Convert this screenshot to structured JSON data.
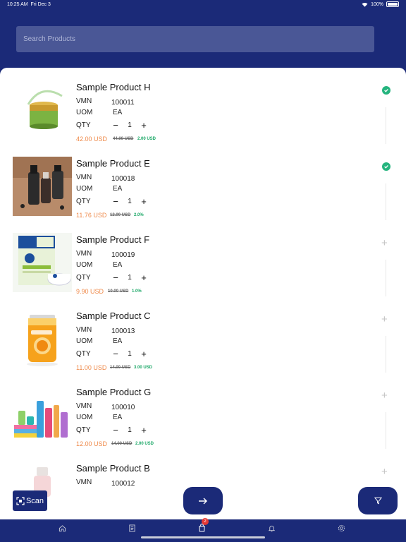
{
  "status_bar": {
    "time": "10:25 AM",
    "date": "Fri Dec 3",
    "battery": "100%"
  },
  "search": {
    "placeholder": "Search Products"
  },
  "labels": {
    "vmn": "VMN",
    "uom": "UOM",
    "qty": "QTY"
  },
  "products": [
    {
      "name": "Sample Product H",
      "vmn": "100011",
      "uom": "EA",
      "qty": "1",
      "price": "42.00 USD",
      "old_price": "44.00 USD",
      "discount": "2.00 USD",
      "selected": true,
      "image": "green-cream-jar"
    },
    {
      "name": "Sample Product E",
      "vmn": "100018",
      "uom": "EA",
      "qty": "1",
      "price": "11.76 USD",
      "old_price": "12.00 USD",
      "discount": "2.0%",
      "selected": true,
      "image": "serum-bottles"
    },
    {
      "name": "Sample Product F",
      "vmn": "100019",
      "uom": "EA",
      "qty": "1",
      "price": "9.90 USD",
      "old_price": "10.00 USD",
      "discount": "1.0%",
      "selected": false,
      "image": "nivea-box"
    },
    {
      "name": "Sample Product C",
      "vmn": "100013",
      "uom": "EA",
      "qty": "1",
      "price": "11.00 USD",
      "old_price": "14.00 USD",
      "discount": "3.00 USD",
      "selected": false,
      "image": "juice-can"
    },
    {
      "name": "Sample Product G",
      "vmn": "100010",
      "uom": "EA",
      "qty": "1",
      "price": "12.00 USD",
      "old_price": "14.00 USD",
      "discount": "2.00 USD",
      "selected": false,
      "image": "toiletries"
    },
    {
      "name": "Sample Product B",
      "vmn": "100012",
      "selected": false,
      "image": "nail-polish"
    }
  ],
  "actions": {
    "scan_label": "Scan"
  },
  "tabbar": {
    "cart_badge": "2",
    "tabs": [
      "home-icon",
      "receipt-icon",
      "cart-icon",
      "bell-icon",
      "gear-icon"
    ]
  },
  "colors": {
    "primary": "#1b2a78",
    "price": "#ef8a4a",
    "discount": "#1aa766",
    "check": "#25b47e"
  }
}
